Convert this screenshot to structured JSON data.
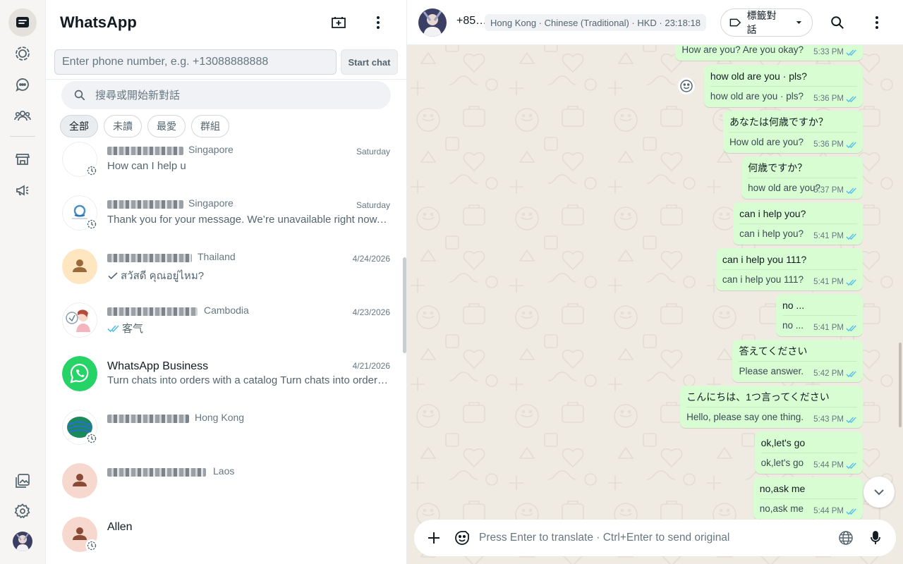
{
  "app": {
    "title": "WhatsApp"
  },
  "phone_input": {
    "placeholder": "Enter phone number, e.g. +13088888888",
    "start_label": "Start chat"
  },
  "search": {
    "placeholder": "搜尋或開始新對話"
  },
  "filters": [
    "全部",
    "未讀",
    "最愛",
    "群組"
  ],
  "chats": [
    {
      "country": "Singapore",
      "time": "Saturday",
      "message": "How can I help u",
      "tick": ""
    },
    {
      "country": "Singapore",
      "time": "Saturday",
      "message": "Thank you for your message. We’re unavailable right now, but we’ll respond as soon as possible.",
      "tick": ""
    },
    {
      "country": "Thailand",
      "time": "4/24/2026",
      "message": "สวัสดี คุณอยู่ไหม?",
      "tick": "single"
    },
    {
      "country": "Cambodia",
      "time": "4/23/2026",
      "message": "客气",
      "tick": "double"
    },
    {
      "name": "WhatsApp Business",
      "time": "4/21/2026",
      "message": "Turn chats into orders with a catalog  Turn chats into orders with a catalog",
      "tick": ""
    },
    {
      "country": "Hong Kong",
      "time": "",
      "message": "",
      "tick": ""
    },
    {
      "country": "Laos",
      "time": "",
      "message": "",
      "tick": ""
    },
    {
      "name": "Allen",
      "time": "",
      "message": "",
      "tick": ""
    }
  ],
  "conversation": {
    "phone": "+85…",
    "info": "Hong Kong · Chinese (Traditional) · HKD · 23:18:18",
    "label_button": "標籤對話",
    "messages": [
      {
        "text": "",
        "translation": "How are you? Are you okay?",
        "time": "5:33 PM"
      },
      {
        "text": "how  old are you  · pls?",
        "translation": "how old are you  · pls?",
        "time": "5:36 PM"
      },
      {
        "text": "あなたは何歳ですか？",
        "translation": "How old are you?",
        "time": "5:36 PM"
      },
      {
        "text": "何歳ですか？",
        "translation": "how old are you?",
        "time": "5:37 PM"
      },
      {
        "text": "can i help you?",
        "translation": "can i help you?",
        "time": "5:41 PM"
      },
      {
        "text": "can i help you  111?",
        "translation": "can i help you 111?",
        "time": "5:41 PM"
      },
      {
        "text": "no ...",
        "translation": "no ...",
        "time": "5:41 PM"
      },
      {
        "text": "答えてください",
        "translation": "Please answer.",
        "time": "5:42 PM"
      },
      {
        "text": "こんにちは、1つ言ってください",
        "translation": "Hello, please say one thing.",
        "time": "5:43 PM"
      },
      {
        "text": "ok,let's go",
        "translation": "ok,let's go",
        "time": "5:44 PM"
      },
      {
        "text": "no,ask me",
        "translation": "no,ask me",
        "time": "5:44 PM"
      }
    ]
  },
  "composer": {
    "placeholder": "Press Enter to translate · Ctrl+Enter to send original"
  },
  "colors": {
    "accent": "#25d366",
    "bubble": "#d9fdd3",
    "read_tick": "#53bdeb",
    "wallpaper": "#efeae2"
  }
}
